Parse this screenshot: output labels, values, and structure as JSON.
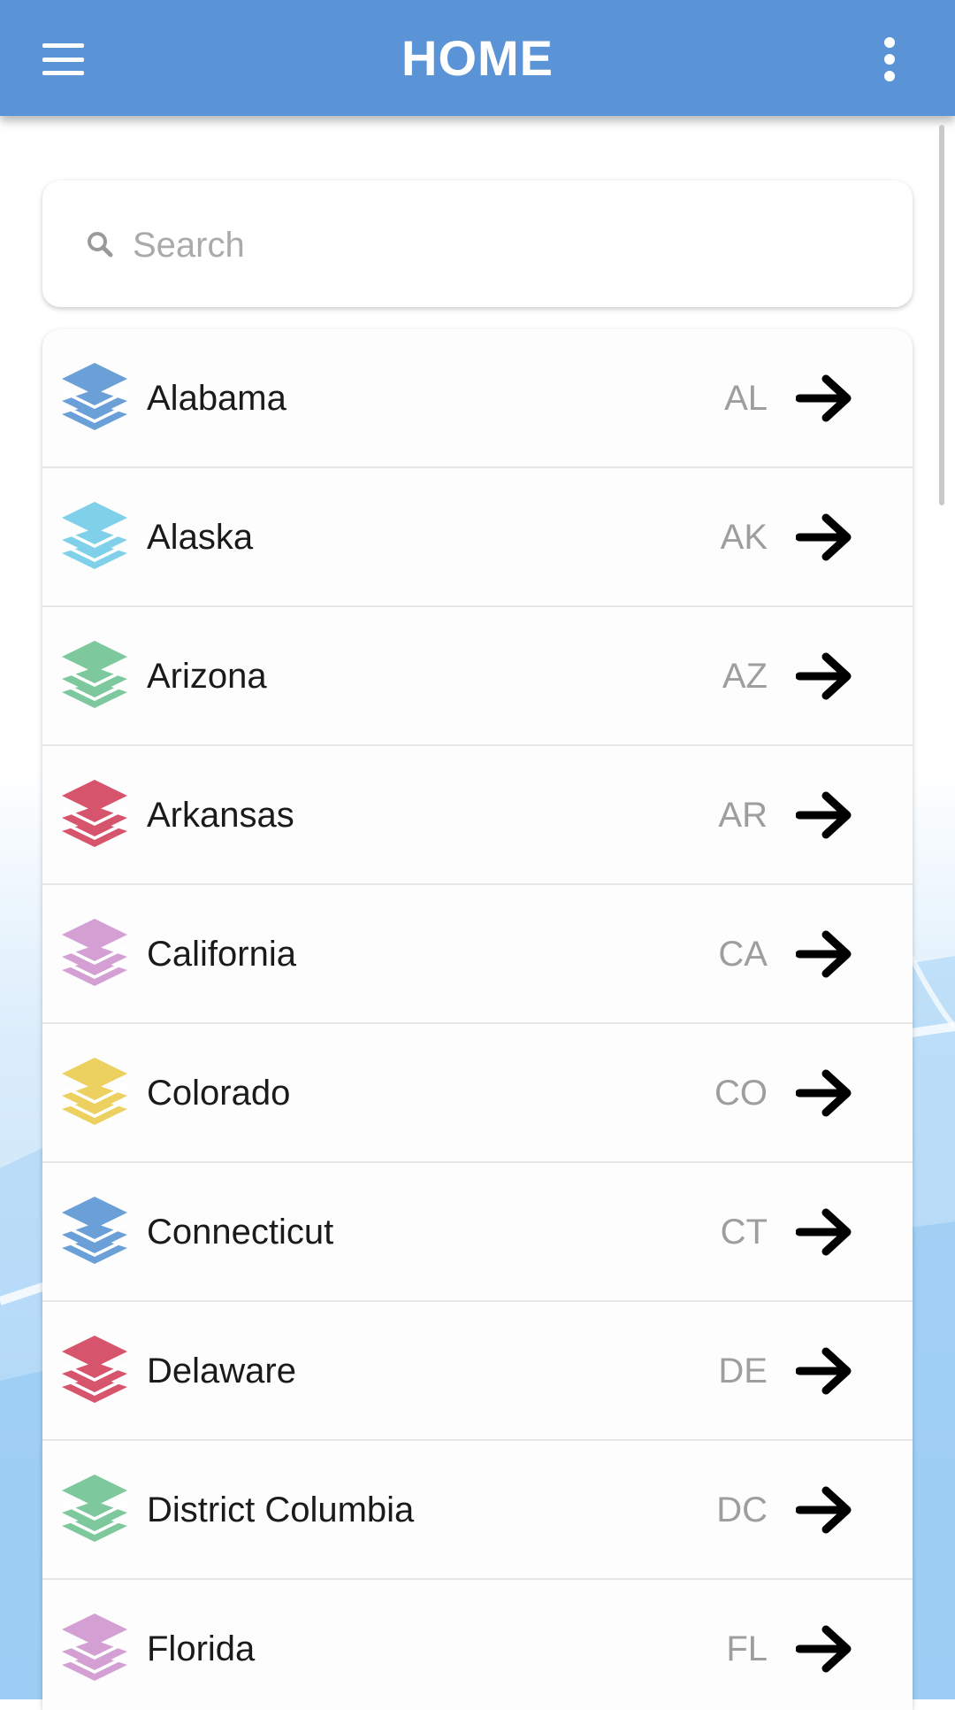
{
  "appbar": {
    "title": "HOME"
  },
  "search": {
    "placeholder": "Search"
  },
  "states": [
    {
      "name": "Alabama",
      "abbr": "AL",
      "color": "#6a9fd8"
    },
    {
      "name": "Alaska",
      "abbr": "AK",
      "color": "#7fd0e8"
    },
    {
      "name": "Arizona",
      "abbr": "AZ",
      "color": "#7dc89c"
    },
    {
      "name": "Arkansas",
      "abbr": "AR",
      "color": "#d6546c"
    },
    {
      "name": "California",
      "abbr": "CA",
      "color": "#d4a0d4"
    },
    {
      "name": "Colorado",
      "abbr": "CO",
      "color": "#ecd060"
    },
    {
      "name": "Connecticut",
      "abbr": "CT",
      "color": "#6a9fd8"
    },
    {
      "name": "Delaware",
      "abbr": "DE",
      "color": "#d6546c"
    },
    {
      "name": "District Columbia",
      "abbr": "DC",
      "color": "#7dc89c"
    },
    {
      "name": "Florida",
      "abbr": "FL",
      "color": "#d4a0d4"
    }
  ],
  "icons": {
    "menu": "hamburger-menu-icon",
    "more": "more-vertical-icon",
    "search": "search-icon",
    "layers": "layers-icon",
    "arrow": "arrow-right-icon"
  }
}
